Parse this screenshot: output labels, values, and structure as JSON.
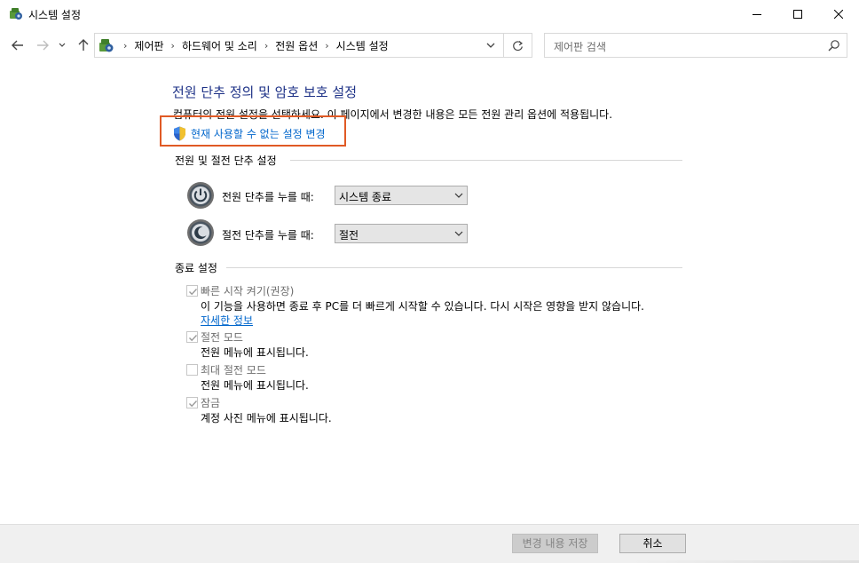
{
  "window": {
    "title": "시스템 설정"
  },
  "nav": {
    "breadcrumbs": [
      "제어판",
      "하드웨어 및 소리",
      "전원 옵션",
      "시스템 설정"
    ],
    "search_placeholder": "제어판 검색"
  },
  "main": {
    "title": "전원 단추 정의 및 암호 보호 설정",
    "description": "컴퓨터의 전원 설정을 선택하세요. 이 페이지에서 변경한 내용은 모든 전원 관리 옵션에 적용됩니다.",
    "admin_link": "현재 사용할 수 없는 설정 변경",
    "power_group": {
      "title": "전원 및 절전 단추 설정",
      "power_button_label": "전원 단추를 누를 때:",
      "power_button_value": "시스템 종료",
      "sleep_button_label": "절전 단추를 누를 때:",
      "sleep_button_value": "절전"
    },
    "shutdown_group": {
      "title": "종료 설정",
      "items": [
        {
          "label": "빠른 시작 켜기(권장)",
          "checked": true,
          "desc": "이 기능을 사용하면 종료 후 PC를 더 빠르게 시작할 수 있습니다. 다시 시작은 영향을 받지 않습니다.",
          "link": "자세한 정보"
        },
        {
          "label": "절전 모드",
          "checked": true,
          "desc": "전원 메뉴에 표시됩니다."
        },
        {
          "label": "최대 절전 모드",
          "checked": false,
          "desc": "전원 메뉴에 표시됩니다."
        },
        {
          "label": "잠금",
          "checked": true,
          "desc": "계정 사진 메뉴에 표시됩니다."
        }
      ]
    }
  },
  "footer": {
    "save_label": "변경 내용 저장",
    "cancel_label": "취소"
  },
  "colors": {
    "title": "#1e3287",
    "link": "#0066cc",
    "highlight": "#e05a25"
  }
}
